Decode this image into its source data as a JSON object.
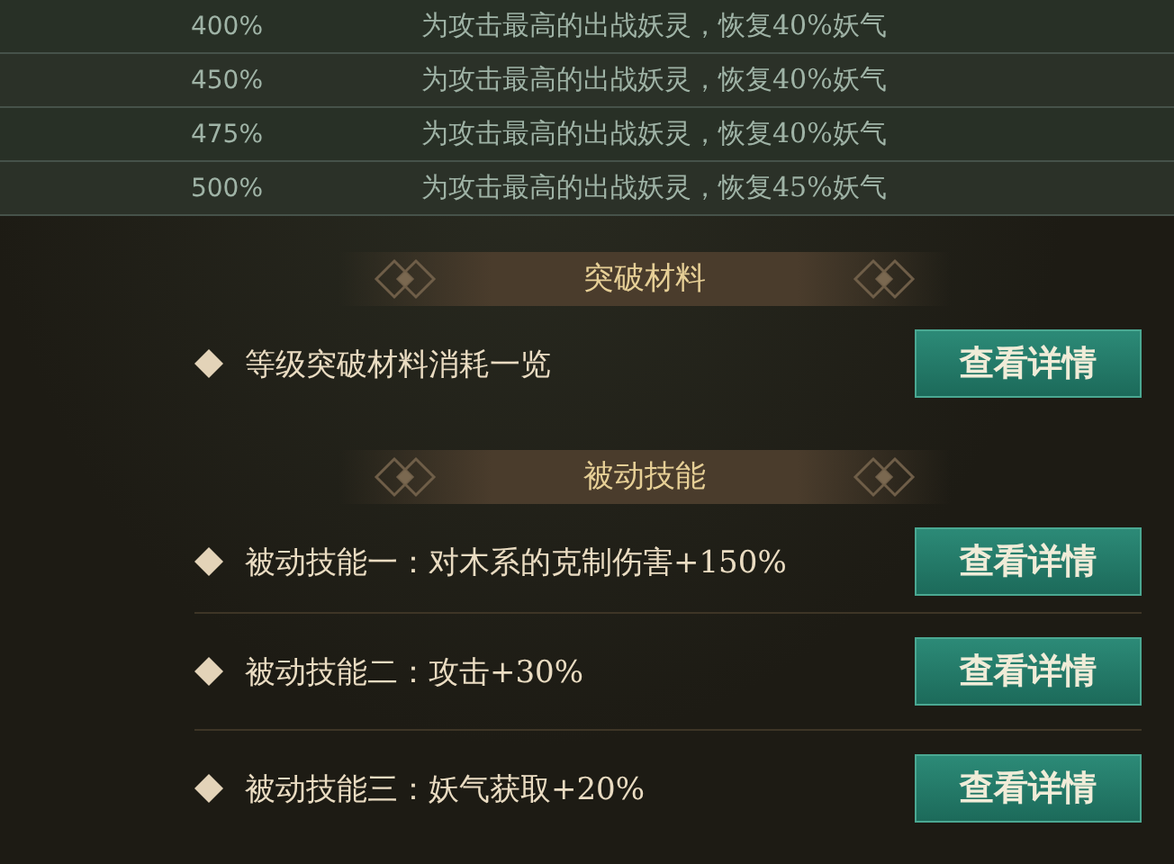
{
  "table": {
    "rows": [
      {
        "multiplier": "400%",
        "effect": "为攻击最高的出战妖灵，恢复40%妖气"
      },
      {
        "multiplier": "450%",
        "effect": "为攻击最高的出战妖灵，恢复40%妖气"
      },
      {
        "multiplier": "475%",
        "effect": "为攻击最高的出战妖灵，恢复40%妖气"
      },
      {
        "multiplier": "500%",
        "effect": "为攻击最高的出战妖灵，恢复45%妖气"
      }
    ]
  },
  "sections": [
    {
      "title": "突破材料",
      "items": [
        {
          "text": "等级突破材料消耗一览",
          "button": "查看详情"
        }
      ]
    },
    {
      "title": "被动技能",
      "items": [
        {
          "text": "被动技能一：对木系的克制伤害+150%",
          "button": "查看详情"
        },
        {
          "text": "被动技能二：攻击+30%",
          "button": "查看详情"
        },
        {
          "text": "被动技能三：妖气获取+20%",
          "button": "查看详情"
        }
      ]
    }
  ]
}
